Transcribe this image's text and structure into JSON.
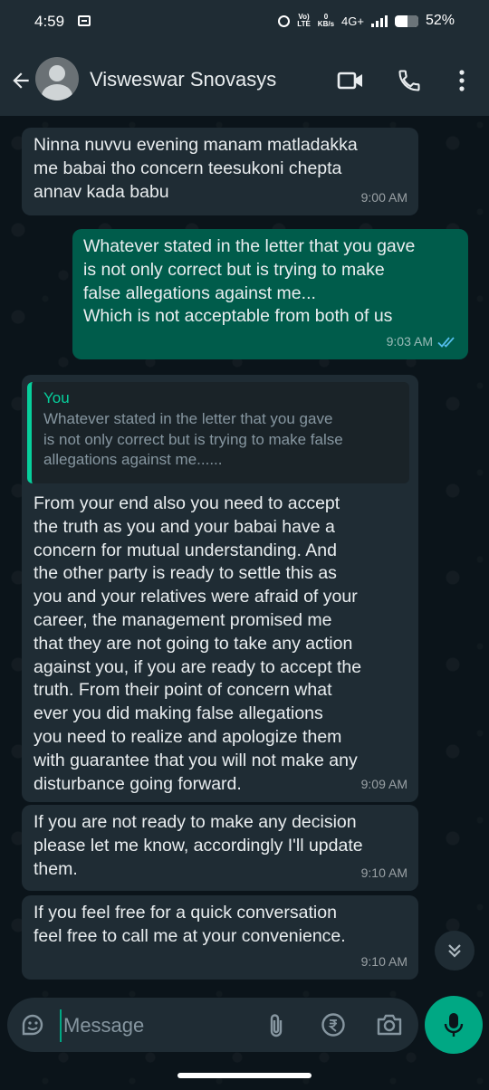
{
  "status_bar": {
    "time": "4:59",
    "volte_top": "Vo)",
    "volte_bottom": "LTE",
    "speed_top": "0",
    "speed_bottom": "KB/s",
    "network": "4G+",
    "battery": "52%"
  },
  "header": {
    "contact_name": "Visweswar Snovasys"
  },
  "messages": [
    {
      "direction": "incoming",
      "text": "Ninna nuvvu evening manam matladakka\nme babai tho concern teesukoni chepta\nannav kada babu",
      "time": "9:00 AM"
    },
    {
      "direction": "outgoing",
      "text": "Whatever stated in the letter that you gave\nis not only correct but is trying to make\nfalse allegations against me...\nWhich is not acceptable from both of us",
      "time": "9:03 AM",
      "status": "read"
    },
    {
      "direction": "incoming",
      "quote_author": "You",
      "quote_text": "Whatever stated in the letter that you gave\nis not only correct but is trying to make false\nallegations against me......",
      "text": "From your end also you need to accept\nthe truth as you and your babai have a\nconcern for mutual understanding. And\nthe other party is ready to settle this as\nyou and your relatives were afraid of your\ncareer, the management promised me\nthat they are not going to take any action\nagainst you, if you are ready to accept the\ntruth. From their point of concern what\never you did making false allegations\nyou need to realize and apologize them\nwith guarantee that you will not make any\ndisturbance going forward.",
      "time": "9:09 AM"
    },
    {
      "direction": "incoming",
      "text": "If you are not ready to make any decision\nplease let me know, accordingly I'll update\nthem.",
      "time": "9:10 AM"
    },
    {
      "direction": "incoming",
      "text": "If you feel free for a quick conversation\nfeel free to call me at your convenience.",
      "time": "9:10 AM"
    }
  ],
  "composer": {
    "placeholder": "Message"
  },
  "colors": {
    "background": "#0b141a",
    "incoming_bubble": "#1f2c34",
    "outgoing_bubble": "#005c4b",
    "accent": "#00a884",
    "read_ticks": "#53bdeb"
  },
  "icons": [
    "back-arrow-icon",
    "avatar-icon",
    "video-call-icon",
    "phone-icon",
    "more-options-icon",
    "double-check-icon",
    "scroll-down-icon",
    "sticker-icon",
    "attach-icon",
    "rupee-icon",
    "camera-icon",
    "mic-icon"
  ]
}
